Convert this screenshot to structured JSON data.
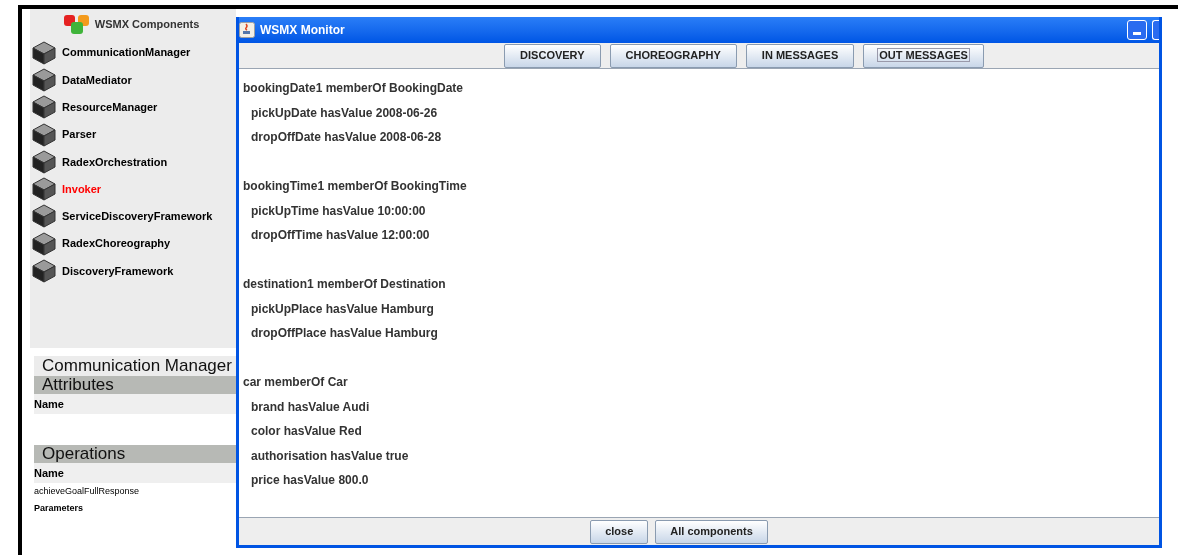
{
  "components_panel": {
    "title": "WSMX Components",
    "items": [
      {
        "label": "CommunicationManager",
        "selected": false
      },
      {
        "label": "DataMediator",
        "selected": false
      },
      {
        "label": "ResourceManager",
        "selected": false
      },
      {
        "label": "Parser",
        "selected": false
      },
      {
        "label": "RadexOrchestration",
        "selected": false
      },
      {
        "label": "Invoker",
        "selected": true
      },
      {
        "label": "ServiceDiscoveryFramework",
        "selected": false
      },
      {
        "label": "RadexChoreography",
        "selected": false
      },
      {
        "label": "DiscoveryFramework",
        "selected": false
      }
    ]
  },
  "mbean": {
    "name": "Communication Manager",
    "sections": [
      {
        "title": "Attributes",
        "header": "Name"
      },
      {
        "title": "Operations",
        "header": "Name",
        "rows": [
          {
            "text": "achieveGoalFullResponse",
            "bold": false
          },
          {
            "text": "Parameters",
            "bold": true
          }
        ]
      }
    ]
  },
  "window": {
    "title": "WSMX Monitor",
    "toolbar": [
      {
        "label": "DISCOVERY",
        "focused": false
      },
      {
        "label": "CHOREOGRAPHY",
        "focused": false
      },
      {
        "label": "IN MESSAGES",
        "focused": false
      },
      {
        "label": "OUT MESSAGES",
        "focused": true
      }
    ],
    "groups": [
      {
        "header": "bookingDate1 memberOf BookingDate",
        "lines": [
          "pickUpDate hasValue 2008-06-26",
          "dropOffDate hasValue 2008-06-28"
        ]
      },
      {
        "header": "bookingTime1 memberOf BookingTime",
        "lines": [
          "pickUpTime hasValue 10:00:00",
          "dropOffTime hasValue 12:00:00"
        ]
      },
      {
        "header": "destination1 memberOf Destination",
        "lines": [
          "pickUpPlace hasValue Hamburg",
          "dropOffPlace hasValue Hamburg"
        ]
      },
      {
        "header": "car memberOf Car",
        "lines": [
          "brand hasValue Audi",
          "color hasValue Red",
          "authorisation hasValue true",
          "price hasValue 800.0"
        ]
      }
    ],
    "buttons": [
      "close",
      "All components"
    ]
  }
}
